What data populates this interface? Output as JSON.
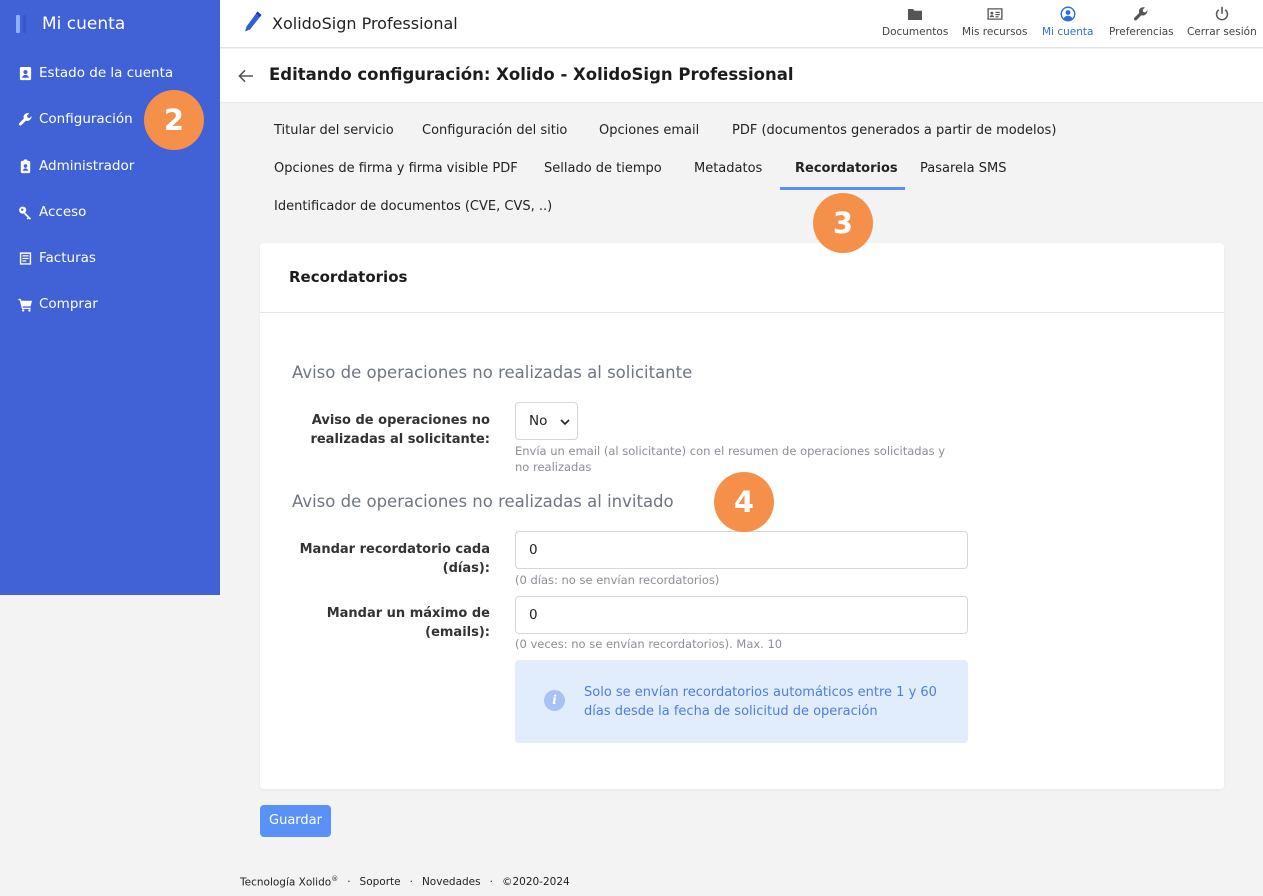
{
  "sidebar": {
    "title": "Mi cuenta",
    "items": [
      {
        "label": "Estado de la cuenta",
        "icon": "contact-card-icon"
      },
      {
        "label": "Configuración",
        "icon": "wrench-icon"
      },
      {
        "label": "Administrador",
        "icon": "id-badge-icon"
      },
      {
        "label": "Acceso",
        "icon": "key-icon"
      },
      {
        "label": "Facturas",
        "icon": "invoice-icon"
      },
      {
        "label": "Comprar",
        "icon": "cart-icon"
      }
    ]
  },
  "topbar": {
    "app_title": "XolidoSign Professional",
    "nav": [
      {
        "label": "Documentos",
        "icon": "folder-icon"
      },
      {
        "label": "Mis recursos",
        "icon": "id-card-icon"
      },
      {
        "label": "Mi cuenta",
        "icon": "user-circle-icon",
        "active": true
      },
      {
        "label": "Preferencias",
        "icon": "wrench-icon"
      },
      {
        "label": "Cerrar sesión",
        "icon": "power-icon"
      }
    ]
  },
  "page": {
    "title": "Editando configuración: Xolido - XolidoSign Professional"
  },
  "tabs": [
    "Titular del servicio",
    "Configuración del sitio",
    "Opciones email",
    "PDF (documentos generados a partir de modelos)",
    "Opciones de firma y firma visible PDF",
    "Sellado de tiempo",
    "Metadatos",
    "Recordatorios",
    "Pasarela SMS",
    "Identificador de documentos (CVE, CVS, ..)"
  ],
  "active_tab": "Recordatorios",
  "card": {
    "title": "Recordatorios",
    "section1": {
      "title": "Aviso de operaciones no realizadas al solicitante",
      "field_label_line1": "Aviso de operaciones no",
      "field_label_line2": "realizadas al solicitante:",
      "select_value": "No",
      "help_line1": "Envía un email (al solicitante) con el resumen de operaciones solicitadas y",
      "help_line2": "no realizadas"
    },
    "section2": {
      "title": "Aviso de operaciones no realizadas al invitado",
      "field1_label_line1": "Mandar recordatorio cada",
      "field1_label_line2": "(días):",
      "field1_value": "0",
      "field1_help": "(0 días: no se envían recordatorios)",
      "field2_label_line1": "Mandar un máximo de",
      "field2_label_line2": "(emails):",
      "field2_value": "0",
      "field2_help": "(0 veces: no se envían recordatorios). Max. 10",
      "info_icon": "i",
      "info_text": "Solo se envían recordatorios automáticos entre 1 y 60 días desde la fecha de solicitud de operación"
    }
  },
  "save_label": "Guardar",
  "footer": {
    "brand": "Tecnología Xolido",
    "reg": "®",
    "links": [
      "Soporte",
      "Novedades"
    ],
    "copyright": "©2020-2024",
    "sep": "·"
  },
  "badges": [
    "2",
    "3",
    "4"
  ],
  "colors": {
    "sidebar": "#4062d6",
    "accent": "#2f6ee0",
    "badge": "#f5904a",
    "save": "#5a91f7",
    "info_bg": "#e1ecfd"
  }
}
